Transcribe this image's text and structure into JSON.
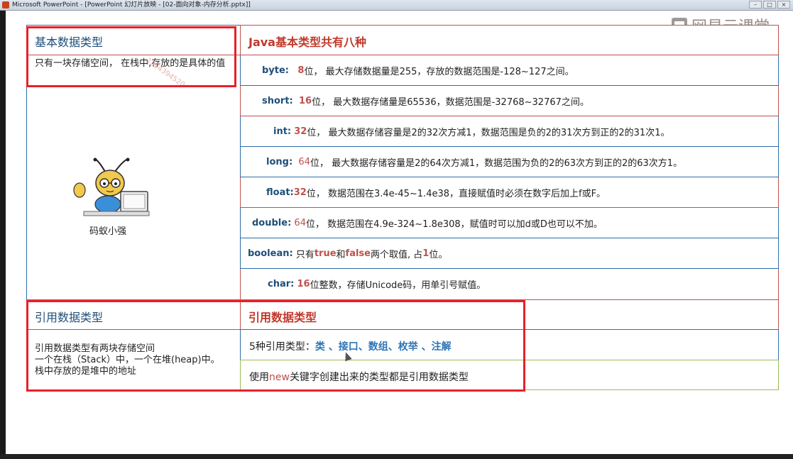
{
  "window": {
    "title": "Microsoft PowerPoint - [PowerPoint 幻灯片放映 - [02-面向对象-内存分析.pptx]]"
  },
  "watermark": {
    "text": "网易云课堂"
  },
  "primitive": {
    "left_header": "基本数据类型",
    "left_desc": "只有一块存储空间， 在栈中,存放的是具体的值",
    "right_header": "Java基本类型共有八种",
    "rows": [
      {
        "kw": "byte:",
        "bits": "8",
        "text": "位， 最大存储数据量是255，存放的数据范围是-128~127之间。"
      },
      {
        "kw": "short:",
        "bits": "16",
        "text": "位， 最大数据存储量是65536，数据范围是-32768~32767之间。"
      },
      {
        "kw": "int:",
        "bits": "32",
        "text": "位， 最大数据存储容量是2的32次方减1，数据范围是负的2的31次方到正的2的31次1。"
      },
      {
        "kw": "long:",
        "bits": "64",
        "text": "位， 最大数据存储容量是2的64次方减1，数据范围为负的2的63次方到正的2的63次方1。"
      },
      {
        "kw": "float:",
        "bits": "32",
        "text": "位， 数据范围在3.4e-45~1.4e38，直接赋值时必须在数字后加上f或F。"
      },
      {
        "kw": "double:",
        "bits": "64",
        "text": "位， 数据范围在4.9e-324~1.8e308，赋值时可以加d或D也可以不加。"
      },
      {
        "kw": "boolean:",
        "pre": "只有",
        "true": "true",
        "and": "和",
        "false": "false",
        "mid": "两个取值, 占",
        "one": "1",
        "end": "位。"
      },
      {
        "kw": "char:",
        "bits": "16",
        "text": "位整数，存储Unicode码，用单引号赋值。"
      }
    ]
  },
  "mascot": {
    "caption": "码蚁小强",
    "overlay_text": "1394394520"
  },
  "reference": {
    "left_header": "引用数据类型",
    "left_desc_1": "引用数据类型有两块存储空间",
    "left_desc_2": "一个在栈（Stack）中，一个在堆(heap)中。",
    "left_desc_3": "栈中存放的是堆中的地址",
    "right_header": "引用数据类型",
    "row1_pre": "5种引用类型：",
    "row1_items": "类 、接口、数组、枚举 、注解",
    "row2_pre": "使用",
    "row2_kw": "new",
    "row2_post": "关键字创建出来的类型都是引用数据类型"
  }
}
